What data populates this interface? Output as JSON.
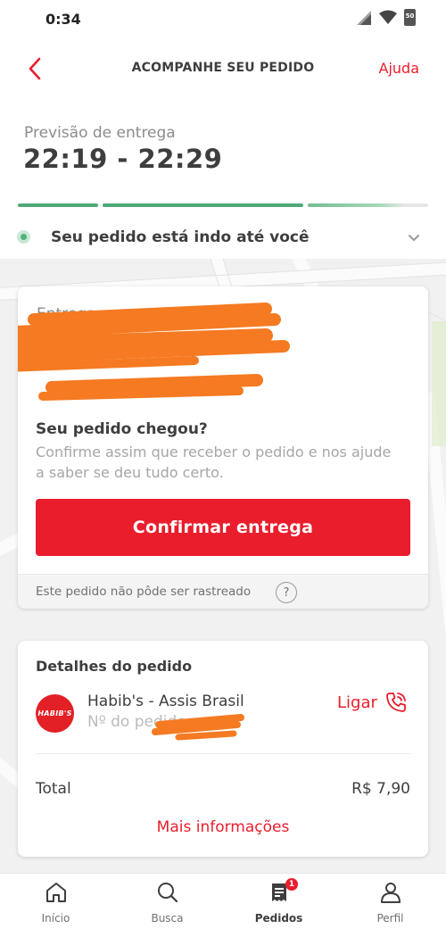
{
  "status_bar": {
    "time": "0:34",
    "battery": "50"
  },
  "header": {
    "title": "ACOMPANHE SEU PEDIDO",
    "help_label": "Ajuda"
  },
  "forecast": {
    "label": "Previsão de entrega",
    "time_range": "22:19 - 22:29"
  },
  "progress": {
    "segments": 3,
    "completed": 3
  },
  "order_status": {
    "text": "Seu pedido está indo até você"
  },
  "delivery_card": {
    "address_label": "Entrega em",
    "arrived_title": "Seu pedido chegou?",
    "arrived_text": "Confirme assim que receber o pedido e nos ajude a saber se deu tudo certo.",
    "confirm_button": "Confirmar entrega",
    "tracking_note": "Este pedido não pôde ser rastreado",
    "help_glyph": "?"
  },
  "order_details": {
    "title": "Detalhes do pedido",
    "store_logo_text": "HABIB'S",
    "store_name": "Habib's - Assis Brasil",
    "order_number_label": "Nº do pedido",
    "call_label": "Ligar",
    "total_label": "Total",
    "total_value": "R$ 7,90",
    "more_info": "Mais informações"
  },
  "bottom_nav": {
    "items": [
      {
        "label": "Início",
        "icon": "home-icon"
      },
      {
        "label": "Busca",
        "icon": "search-icon"
      },
      {
        "label": "Pedidos",
        "icon": "orders-icon",
        "badge": "1",
        "active": true
      },
      {
        "label": "Perfil",
        "icon": "profile-icon"
      }
    ]
  },
  "colors": {
    "brand_red": "#ea1d2c",
    "status_green": "#4fb07a"
  }
}
